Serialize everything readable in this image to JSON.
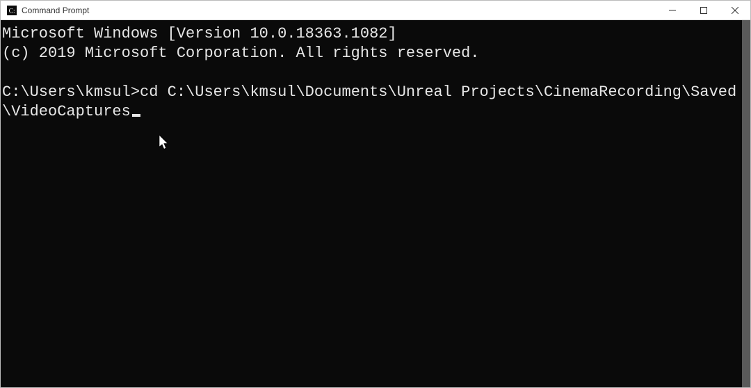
{
  "window": {
    "title": "Command Prompt"
  },
  "terminal": {
    "line1": "Microsoft Windows [Version 10.0.18363.1082]",
    "line2": "(c) 2019 Microsoft Corporation. All rights reserved.",
    "blank": "",
    "prompt": "C:\\Users\\kmsul>",
    "command": "cd C:\\Users\\kmsul\\Documents\\Unreal Projects\\CinemaRecording\\Saved\\VideoCaptures"
  },
  "controls": {
    "minimize": "–",
    "maximize": "▢",
    "close": "✕"
  }
}
